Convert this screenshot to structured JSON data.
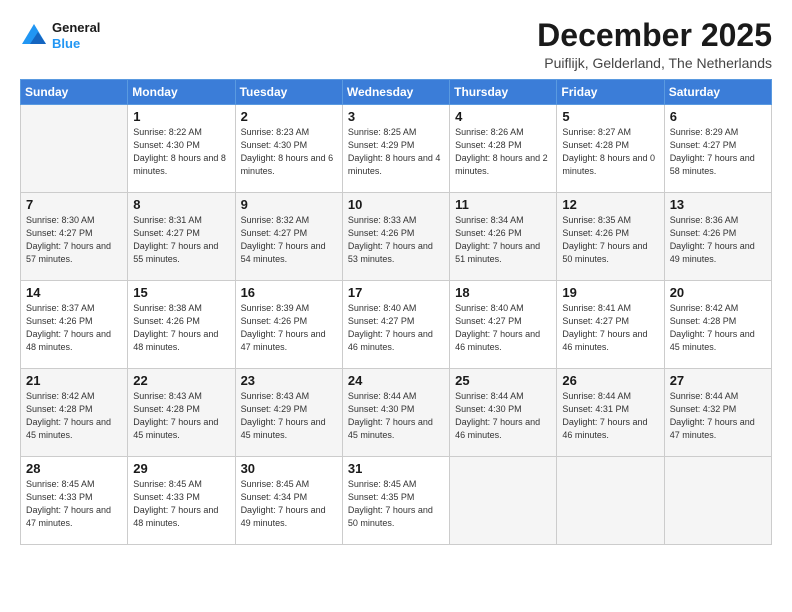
{
  "logo": {
    "line1": "General",
    "line2": "Blue"
  },
  "title": "December 2025",
  "subtitle": "Puiflijk, Gelderland, The Netherlands",
  "days_of_week": [
    "Sunday",
    "Monday",
    "Tuesday",
    "Wednesday",
    "Thursday",
    "Friday",
    "Saturday"
  ],
  "weeks": [
    [
      {
        "day": "",
        "info": ""
      },
      {
        "day": "1",
        "info": "Sunrise: 8:22 AM\nSunset: 4:30 PM\nDaylight: 8 hours\nand 8 minutes."
      },
      {
        "day": "2",
        "info": "Sunrise: 8:23 AM\nSunset: 4:30 PM\nDaylight: 8 hours\nand 6 minutes."
      },
      {
        "day": "3",
        "info": "Sunrise: 8:25 AM\nSunset: 4:29 PM\nDaylight: 8 hours\nand 4 minutes."
      },
      {
        "day": "4",
        "info": "Sunrise: 8:26 AM\nSunset: 4:28 PM\nDaylight: 8 hours\nand 2 minutes."
      },
      {
        "day": "5",
        "info": "Sunrise: 8:27 AM\nSunset: 4:28 PM\nDaylight: 8 hours\nand 0 minutes."
      },
      {
        "day": "6",
        "info": "Sunrise: 8:29 AM\nSunset: 4:27 PM\nDaylight: 7 hours\nand 58 minutes."
      }
    ],
    [
      {
        "day": "7",
        "info": "Sunrise: 8:30 AM\nSunset: 4:27 PM\nDaylight: 7 hours\nand 57 minutes."
      },
      {
        "day": "8",
        "info": "Sunrise: 8:31 AM\nSunset: 4:27 PM\nDaylight: 7 hours\nand 55 minutes."
      },
      {
        "day": "9",
        "info": "Sunrise: 8:32 AM\nSunset: 4:27 PM\nDaylight: 7 hours\nand 54 minutes."
      },
      {
        "day": "10",
        "info": "Sunrise: 8:33 AM\nSunset: 4:26 PM\nDaylight: 7 hours\nand 53 minutes."
      },
      {
        "day": "11",
        "info": "Sunrise: 8:34 AM\nSunset: 4:26 PM\nDaylight: 7 hours\nand 51 minutes."
      },
      {
        "day": "12",
        "info": "Sunrise: 8:35 AM\nSunset: 4:26 PM\nDaylight: 7 hours\nand 50 minutes."
      },
      {
        "day": "13",
        "info": "Sunrise: 8:36 AM\nSunset: 4:26 PM\nDaylight: 7 hours\nand 49 minutes."
      }
    ],
    [
      {
        "day": "14",
        "info": "Sunrise: 8:37 AM\nSunset: 4:26 PM\nDaylight: 7 hours\nand 48 minutes."
      },
      {
        "day": "15",
        "info": "Sunrise: 8:38 AM\nSunset: 4:26 PM\nDaylight: 7 hours\nand 48 minutes."
      },
      {
        "day": "16",
        "info": "Sunrise: 8:39 AM\nSunset: 4:26 PM\nDaylight: 7 hours\nand 47 minutes."
      },
      {
        "day": "17",
        "info": "Sunrise: 8:40 AM\nSunset: 4:27 PM\nDaylight: 7 hours\nand 46 minutes."
      },
      {
        "day": "18",
        "info": "Sunrise: 8:40 AM\nSunset: 4:27 PM\nDaylight: 7 hours\nand 46 minutes."
      },
      {
        "day": "19",
        "info": "Sunrise: 8:41 AM\nSunset: 4:27 PM\nDaylight: 7 hours\nand 46 minutes."
      },
      {
        "day": "20",
        "info": "Sunrise: 8:42 AM\nSunset: 4:28 PM\nDaylight: 7 hours\nand 45 minutes."
      }
    ],
    [
      {
        "day": "21",
        "info": "Sunrise: 8:42 AM\nSunset: 4:28 PM\nDaylight: 7 hours\nand 45 minutes."
      },
      {
        "day": "22",
        "info": "Sunrise: 8:43 AM\nSunset: 4:28 PM\nDaylight: 7 hours\nand 45 minutes."
      },
      {
        "day": "23",
        "info": "Sunrise: 8:43 AM\nSunset: 4:29 PM\nDaylight: 7 hours\nand 45 minutes."
      },
      {
        "day": "24",
        "info": "Sunrise: 8:44 AM\nSunset: 4:30 PM\nDaylight: 7 hours\nand 45 minutes."
      },
      {
        "day": "25",
        "info": "Sunrise: 8:44 AM\nSunset: 4:30 PM\nDaylight: 7 hours\nand 46 minutes."
      },
      {
        "day": "26",
        "info": "Sunrise: 8:44 AM\nSunset: 4:31 PM\nDaylight: 7 hours\nand 46 minutes."
      },
      {
        "day": "27",
        "info": "Sunrise: 8:44 AM\nSunset: 4:32 PM\nDaylight: 7 hours\nand 47 minutes."
      }
    ],
    [
      {
        "day": "28",
        "info": "Sunrise: 8:45 AM\nSunset: 4:33 PM\nDaylight: 7 hours\nand 47 minutes."
      },
      {
        "day": "29",
        "info": "Sunrise: 8:45 AM\nSunset: 4:33 PM\nDaylight: 7 hours\nand 48 minutes."
      },
      {
        "day": "30",
        "info": "Sunrise: 8:45 AM\nSunset: 4:34 PM\nDaylight: 7 hours\nand 49 minutes."
      },
      {
        "day": "31",
        "info": "Sunrise: 8:45 AM\nSunset: 4:35 PM\nDaylight: 7 hours\nand 50 minutes."
      },
      {
        "day": "",
        "info": ""
      },
      {
        "day": "",
        "info": ""
      },
      {
        "day": "",
        "info": ""
      }
    ]
  ]
}
